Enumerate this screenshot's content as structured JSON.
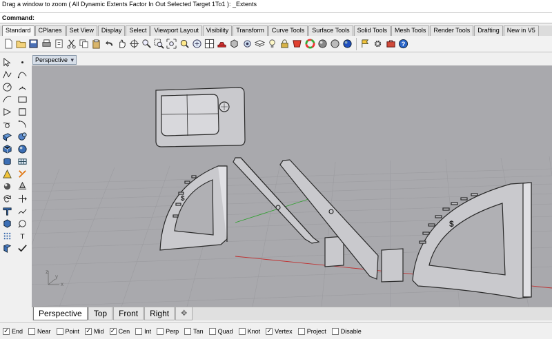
{
  "history": {
    "text": "Drag a window to zoom ( All  Dynamic  Extents  Factor  In  Out  Selected  Target  1To1 ): _Extents"
  },
  "command": {
    "label": "Command:",
    "value": ""
  },
  "tabs": [
    {
      "label": "Standard"
    },
    {
      "label": "CPlanes"
    },
    {
      "label": "Set View"
    },
    {
      "label": "Display"
    },
    {
      "label": "Select"
    },
    {
      "label": "Viewport Layout"
    },
    {
      "label": "Visibility"
    },
    {
      "label": "Transform"
    },
    {
      "label": "Curve Tools"
    },
    {
      "label": "Surface Tools"
    },
    {
      "label": "Solid Tools"
    },
    {
      "label": "Mesh Tools"
    },
    {
      "label": "Render Tools"
    },
    {
      "label": "Drafting"
    },
    {
      "label": "New in V5"
    }
  ],
  "viewport": {
    "title": "Perspective",
    "menu_glyph": "▾",
    "axis_x": "x",
    "axis_y": "y",
    "axis_z": "z"
  },
  "viewport_tabs": [
    {
      "label": "Perspective"
    },
    {
      "label": "Top"
    },
    {
      "label": "Front"
    },
    {
      "label": "Right"
    },
    {
      "label": "✥"
    }
  ],
  "osnaps": [
    {
      "label": "End",
      "checked": true
    },
    {
      "label": "Near",
      "checked": false
    },
    {
      "label": "Point",
      "checked": false
    },
    {
      "label": "Mid",
      "checked": true
    },
    {
      "label": "Cen",
      "checked": true
    },
    {
      "label": "Int",
      "checked": false
    },
    {
      "label": "Perp",
      "checked": false
    },
    {
      "label": "Tan",
      "checked": false
    },
    {
      "label": "Quad",
      "checked": false
    },
    {
      "label": "Knot",
      "checked": false
    },
    {
      "label": "Vertex",
      "checked": true
    },
    {
      "label": "Project",
      "checked": false
    },
    {
      "label": "Disable",
      "checked": false
    }
  ],
  "colors": {
    "viewport_bg": "#a9a9ad",
    "grid": "#9c9ca0",
    "x_axis": "#c03030",
    "y_axis": "#30a030",
    "part_fill": "#c9c9cd"
  }
}
